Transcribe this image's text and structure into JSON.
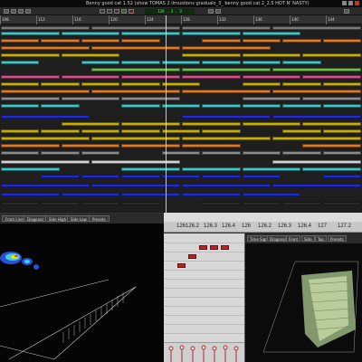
{
  "window": {
    "title": "Benny good cat 1.52 (show TOMAS 2 ilmustions gradualo_3_ benny good cat 2_2.5 HOT N' NASTY)"
  },
  "transport": {
    "lcd_text": "126 . 3 . 3"
  },
  "ruler": {
    "bars": [
      "108",
      "112",
      "116",
      "120",
      "124",
      "128",
      "132",
      "136",
      "140",
      "144"
    ]
  },
  "left_panel": {
    "buttons": [
      "Front Line",
      "Diagonal",
      "Side High",
      "Side Low",
      "Presets"
    ]
  },
  "piano_ruler": {
    "labels": [
      "126",
      "126.2",
      "126.3",
      "126.4",
      "126",
      "126.2",
      "126.3",
      "126.4",
      "127",
      "127.2"
    ]
  },
  "right_panel": {
    "buttons": [
      "Time Sign",
      "Diagonal",
      "Front",
      "Side",
      "Top",
      "Presets"
    ]
  },
  "colors": {
    "arrange_bg": "#1e1e1e",
    "blue_clip": "#1f2ad8",
    "yellow_clip": "#c9b000",
    "orange_clip": "#e07b25",
    "cyan_clip": "#3fc6c9",
    "note_red": "#b0282c"
  }
}
